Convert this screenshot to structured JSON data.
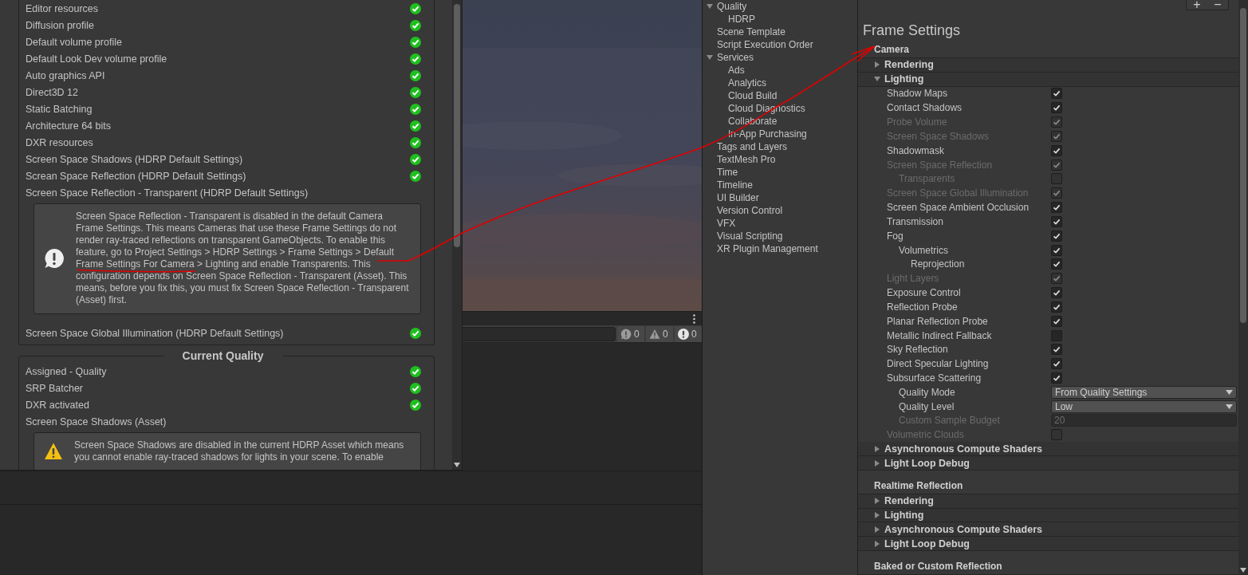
{
  "wizard": {
    "sections": [
      {
        "rows": [
          {
            "kind": "status",
            "label": "Editor resources",
            "passed": true
          },
          {
            "kind": "status",
            "label": "Diffusion profile",
            "passed": true
          },
          {
            "kind": "status",
            "label": "Default volume profile",
            "passed": true
          },
          {
            "kind": "status",
            "label": "Default Look Dev volume profile",
            "passed": true
          },
          {
            "kind": "status",
            "label": "Auto graphics API",
            "passed": true
          },
          {
            "kind": "status",
            "label": "Direct3D 12",
            "passed": true
          },
          {
            "kind": "status",
            "label": "Static Batching",
            "passed": true
          },
          {
            "kind": "status",
            "label": "Architecture 64 bits",
            "passed": true
          },
          {
            "kind": "status",
            "label": "DXR resources",
            "passed": true
          },
          {
            "kind": "status",
            "label": "Screen Space Shadows (HDRP Default Settings)",
            "passed": true
          },
          {
            "kind": "status",
            "label": "Screan Space Reflection (HDRP Default Settings)",
            "passed": true
          },
          {
            "kind": "status",
            "label": "Screen Space Reflection - Transparent (HDRP Default Settings)",
            "passed": false
          },
          {
            "kind": "info",
            "text": "Screen Space Reflection - Transparent is disabled in the default Camera Frame Settings. This means Cameras that use these Frame Settings do not render ray-traced reflections on transparent GameObjects. To enable this feature, go to Project Settings > HDRP Settings > Frame Settings > Default Frame Settings For Camera > Lighting and enable Transparents. This configuration depends on Screen Space Reflection - Transparent (Asset). This means, before you fix this, you must fix Screen Space Reflection - Transparent (Asset) first."
          },
          {
            "kind": "status",
            "label": "Screen Space Global Illumination (HDRP Default Settings)",
            "passed": true
          }
        ]
      },
      {
        "title": "Current Quality",
        "rows": [
          {
            "kind": "status",
            "label": "Assigned - Quality",
            "passed": true
          },
          {
            "kind": "status",
            "label": "SRP Batcher",
            "passed": true
          },
          {
            "kind": "status",
            "label": "DXR activated",
            "passed": true
          },
          {
            "kind": "status",
            "label": "Screen Space Shadows (Asset)",
            "passed": false
          },
          {
            "kind": "warning",
            "text": "Screen Space Shadows are disabled in the current HDRP Asset which means you cannot enable ray-traced shadows for lights in your scene. To enable"
          }
        ]
      }
    ]
  },
  "console": {
    "counters": [
      {
        "kind": "log",
        "count": "0"
      },
      {
        "kind": "warning",
        "count": "0"
      },
      {
        "kind": "error",
        "count": "0"
      }
    ]
  },
  "project_settings": {
    "items": [
      {
        "label": "Quality",
        "expanded": true,
        "children": [
          {
            "label": "HDRP"
          }
        ]
      },
      {
        "label": "Scene Template"
      },
      {
        "label": "Script Execution Order"
      },
      {
        "label": "Services",
        "expanded": true,
        "children": [
          {
            "label": "Ads"
          },
          {
            "label": "Analytics"
          },
          {
            "label": "Cloud Build"
          },
          {
            "label": "Cloud Diagnostics"
          },
          {
            "label": "Collaborate"
          },
          {
            "label": "In-App Purchasing"
          }
        ]
      },
      {
        "label": "Tags and Layers"
      },
      {
        "label": "TextMesh Pro"
      },
      {
        "label": "Time"
      },
      {
        "label": "Timeline"
      },
      {
        "label": "UI Builder"
      },
      {
        "label": "Version Control"
      },
      {
        "label": "VFX"
      },
      {
        "label": "Visual Scripting"
      },
      {
        "label": "XR Plugin Management"
      }
    ]
  },
  "frame_settings": {
    "toolbar_buttons": [
      "+",
      "−"
    ],
    "title": "Frame Settings",
    "groups": [
      {
        "label": "Camera",
        "sections": [
          {
            "label": "Rendering",
            "expanded": false
          },
          {
            "label": "Lighting",
            "expanded": true,
            "items": [
              {
                "kind": "checkbox",
                "label": "Shadow Maps",
                "checked": true,
                "disabled": false
              },
              {
                "kind": "checkbox",
                "label": "Contact Shadows",
                "checked": true,
                "disabled": false
              },
              {
                "kind": "checkbox",
                "label": "Probe Volume",
                "checked": true,
                "disabled": true
              },
              {
                "kind": "checkbox",
                "label": "Screen Space Shadows",
                "checked": true,
                "disabled": true
              },
              {
                "kind": "checkbox",
                "label": "Shadowmask",
                "checked": true,
                "disabled": false
              },
              {
                "kind": "checkbox",
                "label": "Screen Space Reflection",
                "checked": true,
                "disabled": true,
                "children": [
                  {
                    "kind": "checkbox",
                    "label": "Transparents",
                    "checked": false,
                    "disabled": true
                  }
                ]
              },
              {
                "kind": "checkbox",
                "label": "Screen Space Global Illumination",
                "checked": true,
                "disabled": true
              },
              {
                "kind": "checkbox",
                "label": "Screen Space Ambient Occlusion",
                "checked": true,
                "disabled": false
              },
              {
                "kind": "checkbox",
                "label": "Transmission",
                "checked": true,
                "disabled": false
              },
              {
                "kind": "checkbox",
                "label": "Fog",
                "checked": true,
                "disabled": false,
                "children": [
                  {
                    "kind": "checkbox",
                    "label": "Volumetrics",
                    "checked": true,
                    "disabled": false,
                    "children": [
                      {
                        "kind": "checkbox",
                        "label": "Reprojection",
                        "checked": true,
                        "disabled": false
                      }
                    ]
                  }
                ]
              },
              {
                "kind": "checkbox",
                "label": "Light Layers",
                "checked": true,
                "disabled": true
              },
              {
                "kind": "checkbox",
                "label": "Exposure Control",
                "checked": true,
                "disabled": false
              },
              {
                "kind": "checkbox",
                "label": "Reflection Probe",
                "checked": true,
                "disabled": false
              },
              {
                "kind": "checkbox",
                "label": "Planar Reflection Probe",
                "checked": true,
                "disabled": false
              },
              {
                "kind": "checkbox",
                "label": "Metallic Indirect Fallback",
                "checked": false,
                "disabled": false
              },
              {
                "kind": "checkbox",
                "label": "Sky Reflection",
                "checked": true,
                "disabled": false
              },
              {
                "kind": "checkbox",
                "label": "Direct Specular Lighting",
                "checked": true,
                "disabled": false
              },
              {
                "kind": "checkbox",
                "label": "Subsurface Scattering",
                "checked": true,
                "disabled": false,
                "children": [
                  {
                    "kind": "dropdown",
                    "label": "Quality Mode",
                    "value": "From Quality Settings"
                  },
                  {
                    "kind": "dropdown",
                    "label": "Quality Level",
                    "value": "Low"
                  },
                  {
                    "kind": "number",
                    "label": "Custom Sample Budget",
                    "value": "20",
                    "disabled": true
                  }
                ]
              },
              {
                "kind": "checkbox",
                "label": "Volumetric Clouds",
                "checked": false,
                "disabled": true
              }
            ]
          },
          {
            "label": "Asynchronous Compute Shaders",
            "expanded": false
          },
          {
            "label": "Light Loop Debug",
            "expanded": false
          }
        ]
      },
      {
        "label": "Realtime Reflection",
        "sections": [
          {
            "label": "Rendering",
            "expanded": false
          },
          {
            "label": "Lighting",
            "expanded": false
          },
          {
            "label": "Asynchronous Compute Shaders",
            "expanded": false
          },
          {
            "label": "Light Loop Debug",
            "expanded": false
          }
        ]
      },
      {
        "label": "Baked or Custom Reflection"
      }
    ]
  }
}
